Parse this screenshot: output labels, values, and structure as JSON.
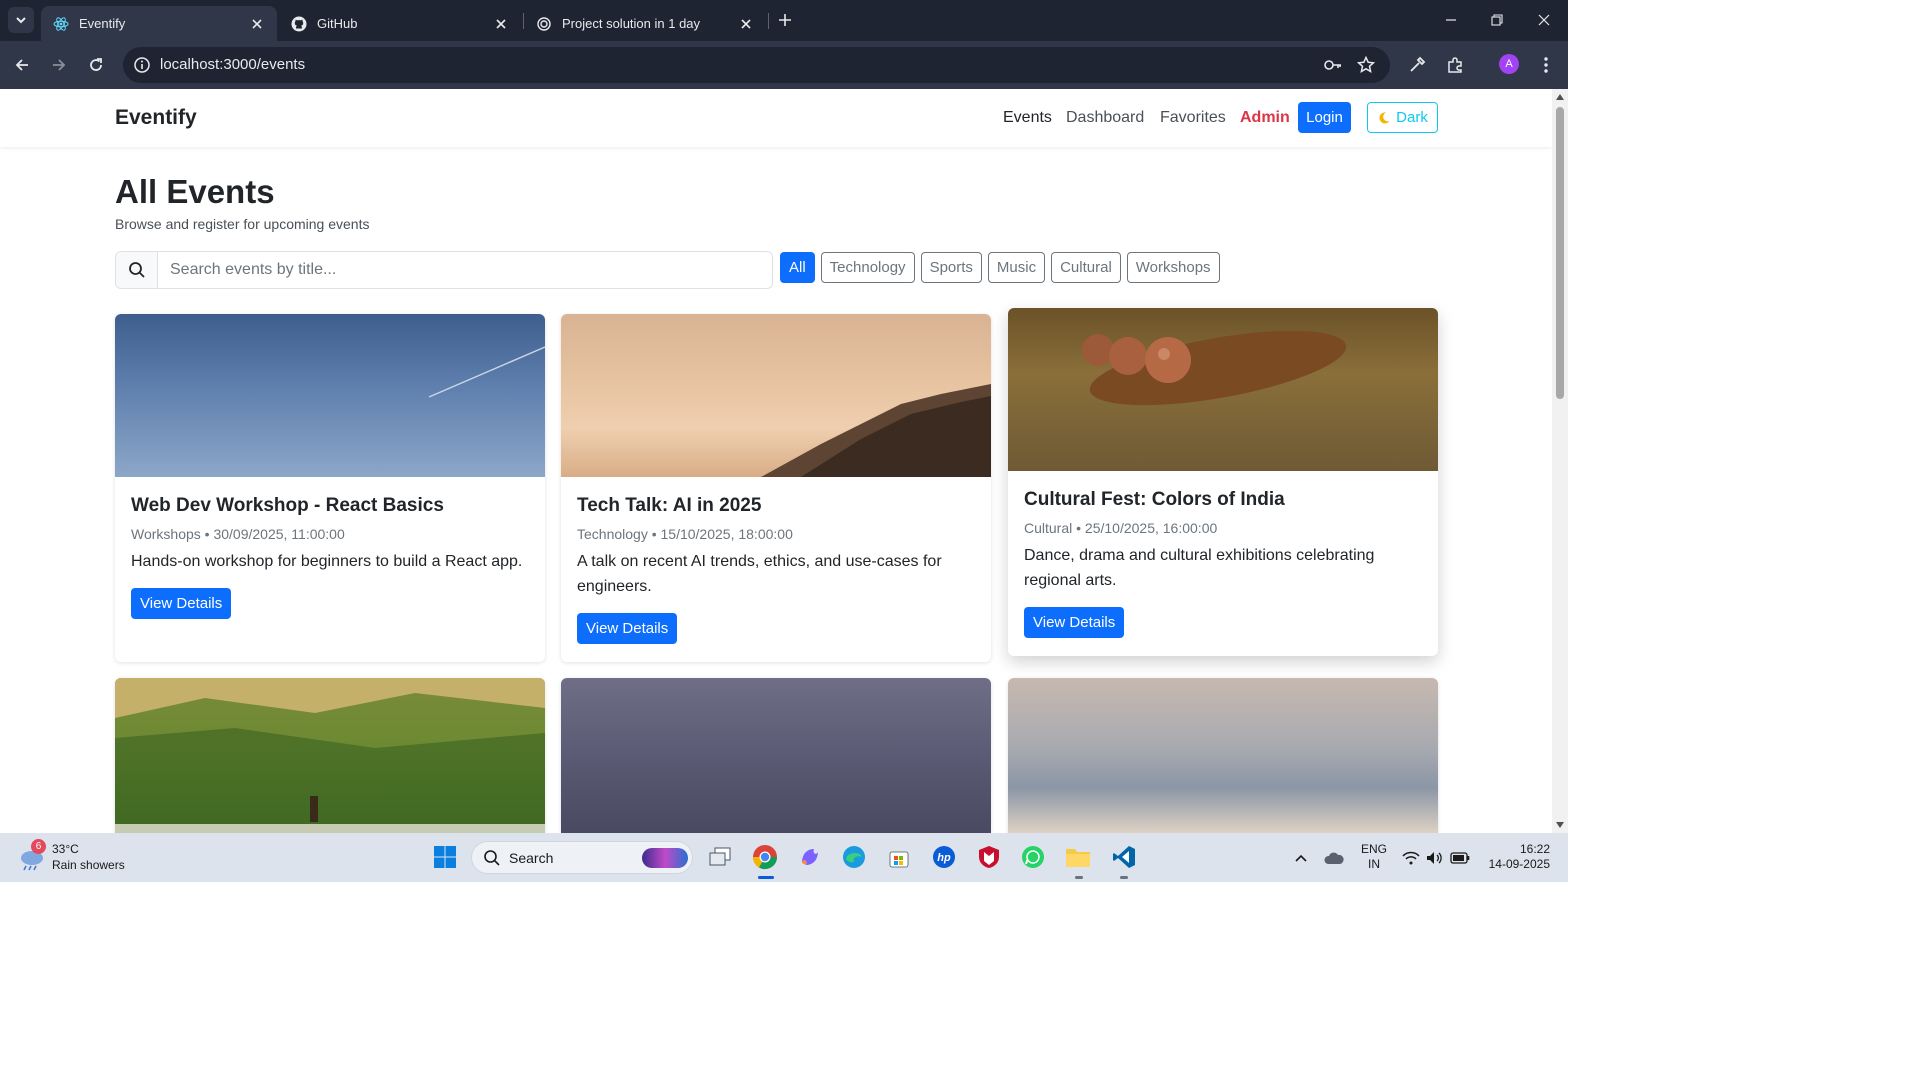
{
  "browser": {
    "tabs": [
      {
        "title": "Eventify",
        "active": true
      },
      {
        "title": "GitHub",
        "active": false
      },
      {
        "title": "Project solution in 1 day",
        "active": false
      }
    ],
    "url": "localhost:3000/events",
    "profile_initial": "A"
  },
  "navbar": {
    "brand": "Eventify",
    "links": [
      "Events",
      "Dashboard",
      "Favorites",
      "Admin"
    ],
    "login": "Login",
    "dark_toggle": "Dark"
  },
  "page": {
    "title": "All Events",
    "subtitle": "Browse and register for upcoming events"
  },
  "search": {
    "placeholder": "Search events by title...",
    "value": ""
  },
  "filters": {
    "options": [
      "All",
      "Technology",
      "Sports",
      "Music",
      "Cultural",
      "Workshops"
    ],
    "selected": "All"
  },
  "events": [
    {
      "title": "Web Dev Workshop - React Basics",
      "meta": "Workshops • 30/09/2025, 11:00:00",
      "description": "Hands-on workshop for beginners to build a React app.",
      "button": "View Details",
      "image": "blue sky with contrail"
    },
    {
      "title": "Tech Talk: AI in 2025",
      "meta": "Technology • 15/10/2025, 18:00:00",
      "description": "A talk on recent AI trends, ethics, and use-cases for engineers.",
      "button": "View Details",
      "image": "misty hills at sunrise"
    },
    {
      "title": "Cultural Fest: Colors of India",
      "meta": "Cultural • 25/10/2025, 16:00:00",
      "description": "Dance, drama and cultural exhibitions celebrating regional arts.",
      "button": "View Details",
      "image": "seed pods on wood"
    },
    {
      "image": "green hills with sheep"
    },
    {
      "image": "stormy sea"
    },
    {
      "image": "clouds from above"
    }
  ],
  "taskbar": {
    "weather_temp": "33°C",
    "weather_cond": "Rain showers",
    "weather_badge": "6",
    "search_label": "Search",
    "lang_line1": "ENG",
    "lang_line2": "IN",
    "time": "16:22",
    "date": "14-09-2025"
  },
  "colors": {
    "primary": "#0d6efd",
    "danger": "#dc3545",
    "info": "#0dcaf0",
    "chrome_dark": "#1f2433"
  }
}
